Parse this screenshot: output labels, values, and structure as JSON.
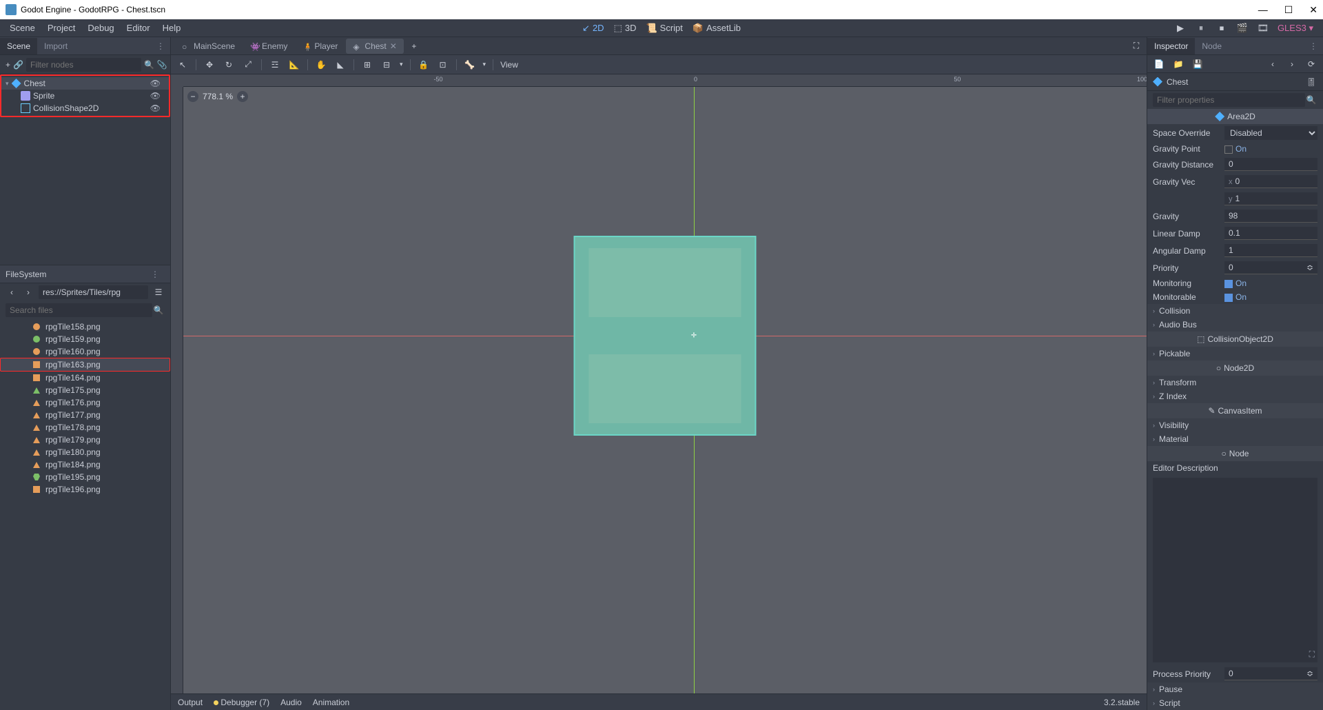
{
  "window": {
    "title": "Godot Engine - GodotRPG - Chest.tscn"
  },
  "menu": {
    "scene": "Scene",
    "project": "Project",
    "debug": "Debug",
    "editor": "Editor",
    "help": "Help"
  },
  "workspace": {
    "d2": "2D",
    "d3": "3D",
    "script": "Script",
    "assetlib": "AssetLib"
  },
  "play": {
    "gles": "GLES3"
  },
  "scene_panel": {
    "tab_scene": "Scene",
    "tab_import": "Import",
    "filter_ph": "Filter nodes",
    "nodes": {
      "root": "Chest",
      "sprite": "Sprite",
      "coll": "CollisionShape2D"
    }
  },
  "filesystem": {
    "title": "FileSystem",
    "path": "res://Sprites/Tiles/rpg",
    "search_ph": "Search files",
    "files": [
      {
        "name": "rpgTile158.png",
        "icon": "orange-dot"
      },
      {
        "name": "rpgTile159.png",
        "icon": "green-dot"
      },
      {
        "name": "rpgTile160.png",
        "icon": "orange-dot"
      },
      {
        "name": "rpgTile163.png",
        "icon": "orange",
        "sel": true
      },
      {
        "name": "rpgTile164.png",
        "icon": "orange"
      },
      {
        "name": "rpgTile175.png",
        "icon": "green-tri"
      },
      {
        "name": "rpgTile176.png",
        "icon": "orange-tri"
      },
      {
        "name": "rpgTile177.png",
        "icon": "orange-tri"
      },
      {
        "name": "rpgTile178.png",
        "icon": "orange-tri"
      },
      {
        "name": "rpgTile179.png",
        "icon": "orange-tri"
      },
      {
        "name": "rpgTile180.png",
        "icon": "orange-tri"
      },
      {
        "name": "rpgTile184.png",
        "icon": "orange-tri"
      },
      {
        "name": "rpgTile195.png",
        "icon": "green-cup"
      },
      {
        "name": "rpgTile196.png",
        "icon": "orange"
      }
    ]
  },
  "scene_tabs": [
    {
      "name": "MainScene",
      "icon": "circle"
    },
    {
      "name": "Enemy",
      "icon": "enemy"
    },
    {
      "name": "Player",
      "icon": "player"
    },
    {
      "name": "Chest",
      "icon": "area2d",
      "active": true
    }
  ],
  "viewport": {
    "zoom": "778.1 %",
    "view_label": "View",
    "tick_neg50": "-50",
    "tick_0": "0",
    "tick_50": "50",
    "tick_100": "100"
  },
  "bottom": {
    "output": "Output",
    "debugger": "Debugger (7)",
    "audio": "Audio",
    "animation": "Animation",
    "version": "3.2.stable"
  },
  "inspector": {
    "tab_inspector": "Inspector",
    "tab_node": "Node",
    "title_node": "Chest",
    "filter_ph": "Filter properties",
    "class_area2d": "Area2D",
    "props": {
      "space_override": {
        "label": "Space Override",
        "value": "Disabled"
      },
      "gravity_point": {
        "label": "Gravity Point",
        "value": "On",
        "checked": false
      },
      "gravity_distance": {
        "label": "Gravity Distance",
        "value": "0"
      },
      "gravity_vec": {
        "label": "Gravity Vec",
        "x": "0",
        "y": "1"
      },
      "gravity": {
        "label": "Gravity",
        "value": "98"
      },
      "linear_damp": {
        "label": "Linear Damp",
        "value": "0.1"
      },
      "angular_damp": {
        "label": "Angular Damp",
        "value": "1"
      },
      "priority": {
        "label": "Priority",
        "value": "0"
      },
      "monitoring": {
        "label": "Monitoring",
        "value": "On",
        "checked": true
      },
      "monitorable": {
        "label": "Monitorable",
        "value": "On",
        "checked": true
      }
    },
    "sections": {
      "collision": "Collision",
      "audio_bus": "Audio Bus",
      "class_collobj": "CollisionObject2D",
      "pickable": "Pickable",
      "class_node2d": "Node2D",
      "transform": "Transform",
      "zindex": "Z Index",
      "class_canvas": "CanvasItem",
      "visibility": "Visibility",
      "material": "Material",
      "class_node": "Node",
      "editor_desc": "Editor Description",
      "process_priority": {
        "label": "Process Priority",
        "value": "0"
      },
      "pause": "Pause",
      "script": "Script"
    }
  }
}
